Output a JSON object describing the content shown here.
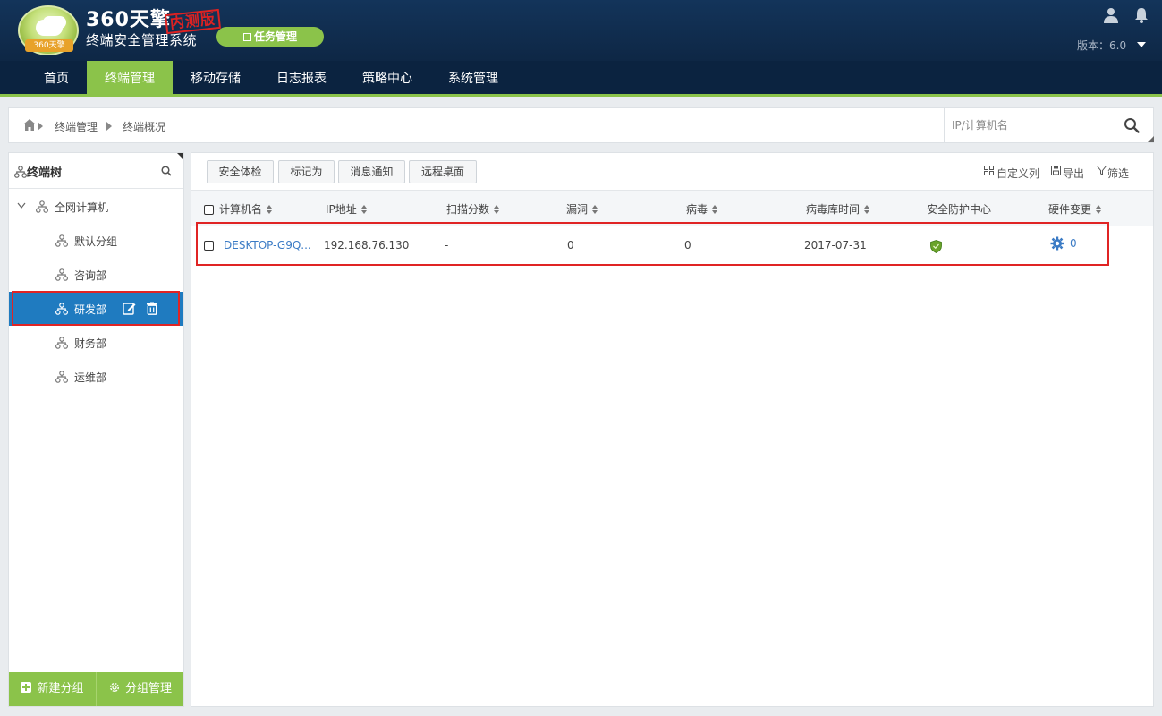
{
  "header": {
    "brand_top": "360天擎",
    "brand_stamp": "内测版",
    "brand_bottom": "终端安全管理系统",
    "badge_text": "360天擎",
    "task_button": "任务管理",
    "version": "版本：6.0"
  },
  "nav": {
    "items": [
      "首页",
      "终端管理",
      "移动存储",
      "日志报表",
      "策略中心",
      "系统管理"
    ],
    "active": "终端管理"
  },
  "breadcrumb": {
    "items": [
      "终端管理",
      "终端概况"
    ]
  },
  "search": {
    "placeholder": "IP/计算机名"
  },
  "sidebar": {
    "title": "终端树",
    "root": "全网计算机",
    "groups": [
      "默认分组",
      "咨询部",
      "研发部",
      "财务部",
      "运维部"
    ],
    "selected": "研发部",
    "new_group": "新建分组",
    "manage_group": "分组管理"
  },
  "toolbar": {
    "buttons": [
      "安全体检",
      "标记为",
      "消息通知",
      "远程桌面"
    ],
    "custom_columns": "自定义列",
    "export": "导出",
    "filter": "筛选"
  },
  "table": {
    "columns": [
      "计算机名",
      "IP地址",
      "扫描分数",
      "漏洞",
      "病毒",
      "病毒库时间",
      "安全防护中心",
      "硬件变更"
    ],
    "rows": [
      {
        "name": "DESKTOP-G9Q...",
        "ip": "192.168.76.130",
        "score": "-",
        "vuln": "0",
        "virus": "0",
        "virus_db_time": "2017-07-31",
        "protection": "shield-icon",
        "hw_change": "0"
      }
    ]
  },
  "colors": {
    "accent_green": "#8bc34a",
    "header_navy": "#0e2745",
    "selected_blue": "#1f7bc0",
    "highlight_red": "#e02424",
    "link_blue": "#3b7bc5"
  }
}
